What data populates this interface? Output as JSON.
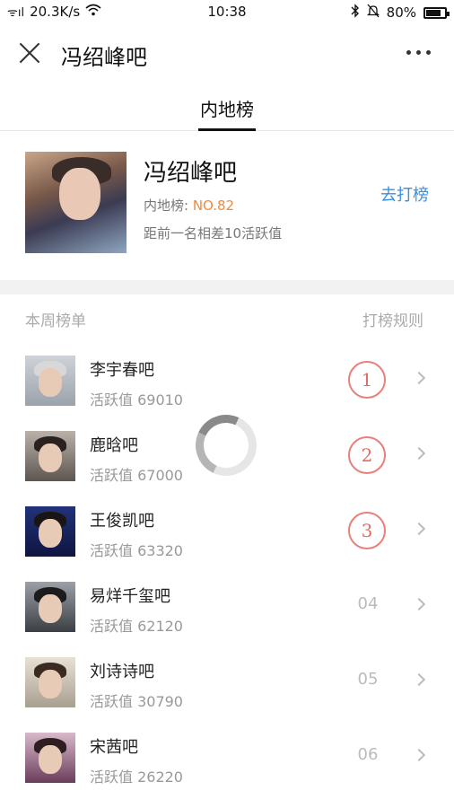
{
  "status_bar": {
    "signal": "ᯤıl",
    "speed": "20.3K/s",
    "time": "10:38",
    "bluetooth": "bluetooth-icon",
    "mute": "bell-off-icon",
    "battery_text": "80%",
    "battery_level": 0.8
  },
  "title_bar": {
    "title": "冯绍峰吧",
    "close_icon": "close-icon",
    "more_icon": "more-icon"
  },
  "tabs": [
    "内地榜"
  ],
  "header_card": {
    "name": "冯绍峰吧",
    "rank_label": "内地榜: ",
    "rank_value": "NO.82",
    "gap_text": "距前一名相差10活跃值",
    "action_label": "去打榜"
  },
  "section": {
    "title": "本周榜单",
    "rule_link": "打榜规则"
  },
  "ranking": [
    {
      "name": "李宇春吧",
      "score": "活跃值 69010",
      "rank": "1",
      "medal": true
    },
    {
      "name": "鹿晗吧",
      "score": "活跃值 67000",
      "rank": "2",
      "medal": true
    },
    {
      "name": "王俊凯吧",
      "score": "活跃值 63320",
      "rank": "3",
      "medal": true
    },
    {
      "name": "易烊千玺吧",
      "score": "活跃值 62120",
      "rank": "04",
      "medal": false
    },
    {
      "name": "刘诗诗吧",
      "score": "活跃值 30790",
      "rank": "05",
      "medal": false
    },
    {
      "name": "宋茜吧",
      "score": "活跃值 26220",
      "rank": "06",
      "medal": false
    }
  ],
  "colors": {
    "accent_blue": "#3a8ee6",
    "rank_orange": "#f08a3c",
    "medal_red": "#e26c64"
  }
}
